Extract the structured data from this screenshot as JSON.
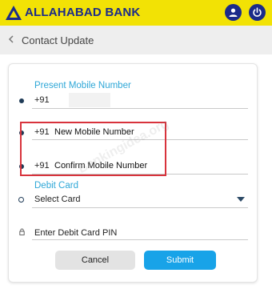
{
  "app": {
    "bank_name": "ALLAHABAD BANK"
  },
  "header": {
    "title": "Contact Update"
  },
  "form": {
    "present_mobile": {
      "label": "Present Mobile Number",
      "prefix": "+91"
    },
    "new_mobile": {
      "prefix": "+91",
      "placeholder": "New Mobile Number"
    },
    "confirm_mobile": {
      "prefix": "+91",
      "placeholder": "Confirm Mobile Number"
    },
    "debit_card": {
      "label": "Debit Card",
      "selected": "Select Card"
    },
    "pin": {
      "placeholder": "Enter Debit Card PIN"
    }
  },
  "buttons": {
    "cancel": "Cancel",
    "submit": "Submit"
  },
  "watermark": "Bankingidea.org",
  "colors": {
    "topbar": "#f2e205",
    "brand_blue": "#1b2b8a",
    "accent": "#18a3e8",
    "highlight": "#d8333c"
  },
  "icons": {
    "logo": "bank-logo-icon",
    "profile": "user-icon",
    "logout": "power-icon",
    "back": "chevron-left-icon",
    "dropdown": "caret-down-icon",
    "pin": "lock-icon"
  }
}
